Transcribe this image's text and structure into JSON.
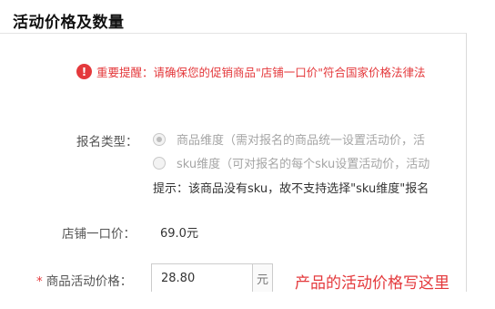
{
  "section": {
    "title": "活动价格及数量"
  },
  "warning": {
    "icon": "exclamation-circle-icon",
    "icon_glyph": "!",
    "text": "重要提醒：请确保您的促销商品\"店铺一口价\"符合国家价格法律法"
  },
  "form": {
    "signup_type": {
      "label": "报名类型：",
      "options": [
        {
          "text": "商品维度（需对报名的商品统一设置活动价，活",
          "selected": true,
          "disabled": true
        },
        {
          "text": "sku维度（可对报名的每个sku设置活动价，活动",
          "selected": false,
          "disabled": true
        }
      ],
      "hint": "提示：该商品没有sku，故不支持选择\"sku维度\"报名"
    },
    "store_price": {
      "label": "店铺一口价：",
      "value": "69.0元"
    },
    "activity_price": {
      "required_mark": "*",
      "label": "商品活动价格：",
      "value": "28.80",
      "unit": "元"
    }
  },
  "annotation": {
    "text": "产品的活动价格写这里"
  },
  "colors": {
    "accent_red": "#e4393c",
    "disabled_gray": "#a5a5a5",
    "border": "#cccccc"
  }
}
